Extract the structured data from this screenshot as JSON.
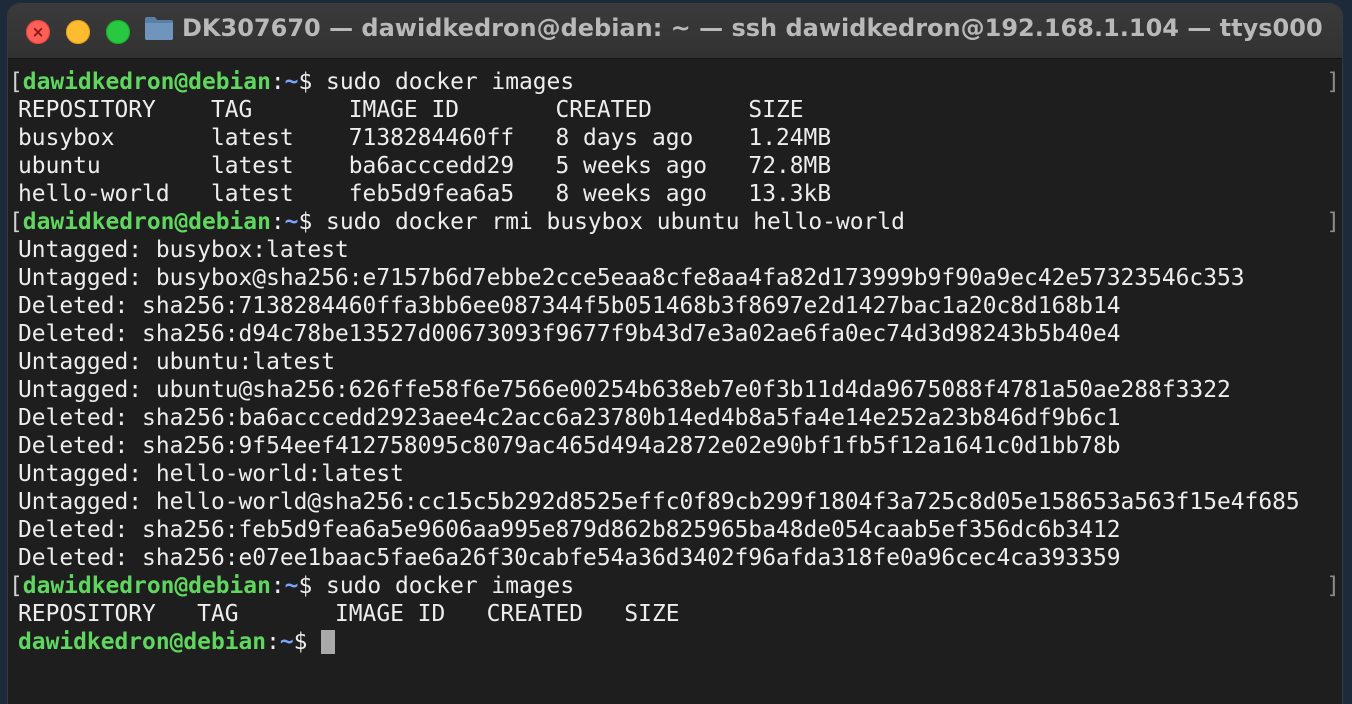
{
  "window": {
    "title": "DK307670 — dawidkedron@debian: ~ — ssh dawidkedron@192.168.1.104 — ttys000",
    "buttons": {
      "close": "close-button",
      "minimize": "minimize-button",
      "zoom": "zoom-button"
    }
  },
  "prompt": {
    "user": "dawidkedron@debian",
    "sep": ":",
    "path": "~",
    "symbol": "$"
  },
  "lines": [
    {
      "type": "cmd",
      "text": " sudo docker images"
    },
    {
      "type": "out",
      "text": "REPOSITORY    TAG       IMAGE ID       CREATED       SIZE"
    },
    {
      "type": "out",
      "text": "busybox       latest    7138284460ff   8 days ago    1.24MB"
    },
    {
      "type": "out",
      "text": "ubuntu        latest    ba6acccedd29   5 weeks ago   72.8MB"
    },
    {
      "type": "out",
      "text": "hello-world   latest    feb5d9fea6a5   8 weeks ago   13.3kB"
    },
    {
      "type": "cmd",
      "text": " sudo docker rmi busybox ubuntu hello-world"
    },
    {
      "type": "out",
      "text": "Untagged: busybox:latest"
    },
    {
      "type": "out",
      "text": "Untagged: busybox@sha256:e7157b6d7ebbe2cce5eaa8cfe8aa4fa82d173999b9f90a9ec42e57323546c353"
    },
    {
      "type": "out",
      "text": "Deleted: sha256:7138284460ffa3bb6ee087344f5b051468b3f8697e2d1427bac1a20c8d168b14"
    },
    {
      "type": "out",
      "text": "Deleted: sha256:d94c78be13527d00673093f9677f9b43d7e3a02ae6fa0ec74d3d98243b5b40e4"
    },
    {
      "type": "out",
      "text": "Untagged: ubuntu:latest"
    },
    {
      "type": "out",
      "text": "Untagged: ubuntu@sha256:626ffe58f6e7566e00254b638eb7e0f3b11d4da9675088f4781a50ae288f3322"
    },
    {
      "type": "out",
      "text": "Deleted: sha256:ba6acccedd2923aee4c2acc6a23780b14ed4b8a5fa4e14e252a23b846df9b6c1"
    },
    {
      "type": "out",
      "text": "Deleted: sha256:9f54eef412758095c8079ac465d494a2872e02e90bf1fb5f12a1641c0d1bb78b"
    },
    {
      "type": "out",
      "text": "Untagged: hello-world:latest"
    },
    {
      "type": "out",
      "text": "Untagged: hello-world@sha256:cc15c5b292d8525effc0f89cb299f1804f3a725c8d05e158653a563f15e4f685"
    },
    {
      "type": "out",
      "text": "Deleted: sha256:feb5d9fea6a5e9606aa995e879d862b825965ba48de054caab5ef356dc6b3412"
    },
    {
      "type": "out",
      "text": "Deleted: sha256:e07ee1baac5fae6a26f30cabfe54a36d3402f96afda318fe0a96cec4ca393359"
    },
    {
      "type": "cmd",
      "text": " sudo docker images"
    },
    {
      "type": "out",
      "text": "REPOSITORY   TAG       IMAGE ID   CREATED   SIZE"
    },
    {
      "type": "prompt",
      "text": " "
    }
  ]
}
